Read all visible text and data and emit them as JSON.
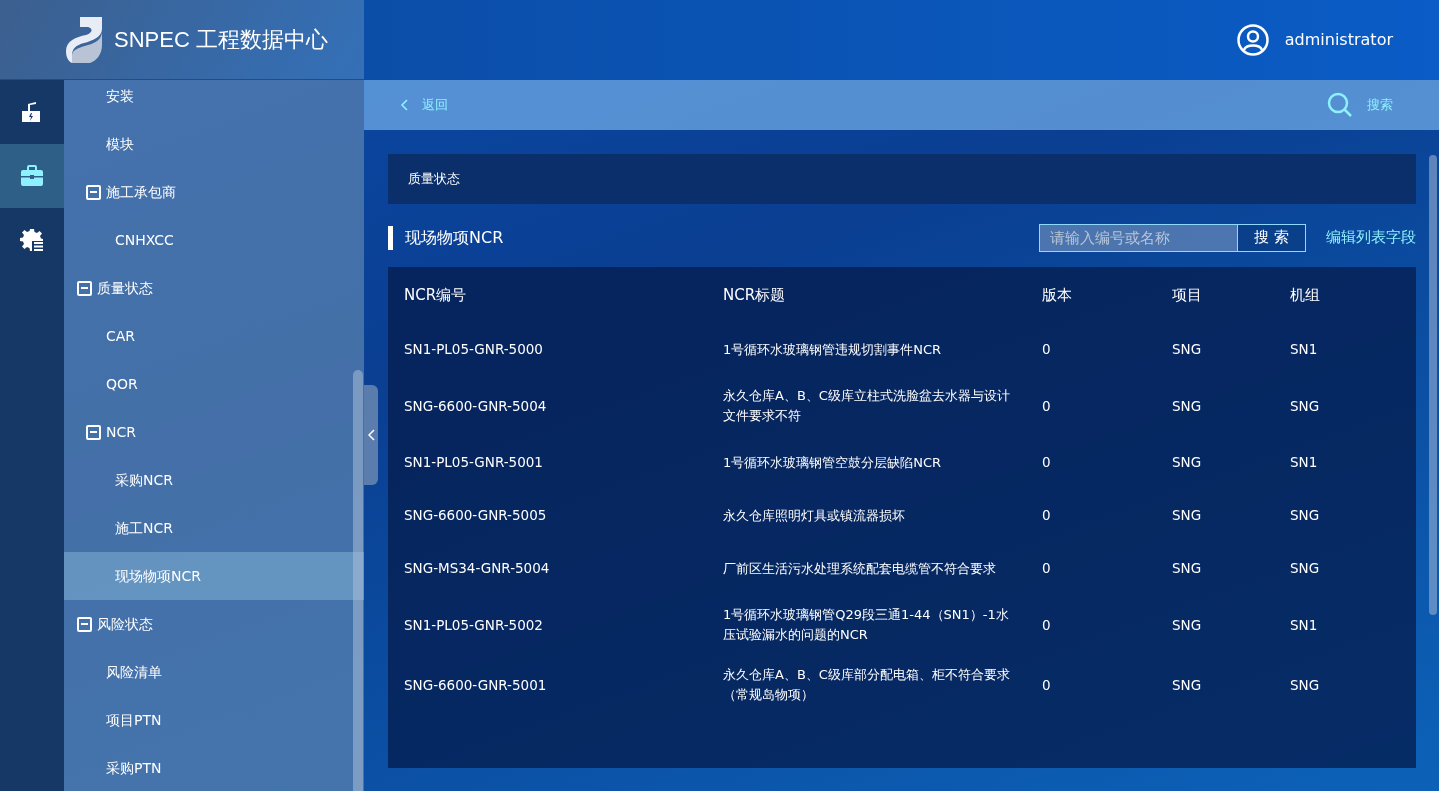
{
  "header": {
    "title": "SNPEC 工程数据中心",
    "user": "administrator"
  },
  "rail": [
    {
      "selected": false
    },
    {
      "selected": true
    },
    {
      "selected": false
    }
  ],
  "sidebar": {
    "items": [
      {
        "children": [
          {
            "label": "安装",
            "selected": false
          },
          {
            "label": "模块",
            "selected": false
          },
          {
            "label": "施工承包商",
            "expanded": true,
            "selected": false,
            "children": [
              {
                "label": "CNHXCC",
                "selected": false
              }
            ]
          }
        ]
      },
      {
        "label": "质量状态",
        "expanded": true,
        "selected": false,
        "children": [
          {
            "label": "CAR",
            "selected": false
          },
          {
            "label": "QOR",
            "selected": false
          },
          {
            "label": "NCR",
            "expanded": true,
            "selected": false,
            "children": [
              {
                "label": "采购NCR",
                "selected": false
              },
              {
                "label": "施工NCR",
                "selected": false
              },
              {
                "label": "现场物项NCR",
                "selected": true
              }
            ]
          }
        ]
      },
      {
        "label": "风险状态",
        "expanded": true,
        "selected": false,
        "children": [
          {
            "label": "风险清单",
            "selected": false
          },
          {
            "label": "项目PTN",
            "selected": false
          },
          {
            "label": "采购PTN",
            "selected": false
          }
        ]
      }
    ]
  },
  "toolbar": {
    "back": "返回",
    "search": "搜索"
  },
  "breadcrumb": "质量状态",
  "section": {
    "title": "现场物项NCR",
    "search_placeholder": "请输入编号或名称",
    "search_button": "搜 索",
    "edit_fields": "编辑列表字段"
  },
  "table": {
    "columns": [
      "NCR编号",
      "NCR标题",
      "版本",
      "项目",
      "机组"
    ],
    "rows": [
      [
        "SN1-PL05-GNR-5000",
        "1号循环水玻璃钢管违规切割事件NCR",
        "0",
        "SNG",
        "SN1"
      ],
      [
        "SNG-6600-GNR-5004",
        "永久仓库A、B、C级库立柱式洗脸盆去水器与设计文件要求不符",
        "0",
        "SNG",
        "SNG"
      ],
      [
        "SN1-PL05-GNR-5001",
        "1号循环水玻璃钢管空鼓分层缺陷NCR",
        "0",
        "SNG",
        "SN1"
      ],
      [
        "SNG-6600-GNR-5005",
        "永久仓库照明灯具或镇流器损坏",
        "0",
        "SNG",
        "SNG"
      ],
      [
        "SNG-MS34-GNR-5004",
        "厂前区生活污水处理系统配套电缆管不符合要求",
        "0",
        "SNG",
        "SNG"
      ],
      [
        "SN1-PL05-GNR-5002",
        "1号循环水玻璃钢管Q29段三通1-44（SN1）-1水压试验漏水的问题的NCR",
        "0",
        "SNG",
        "SN1"
      ],
      [
        "SNG-6600-GNR-5001",
        "永久仓库A、B、C级库部分配电箱、柜不符合要求（常规岛物项）",
        "0",
        "SNG",
        "SNG"
      ]
    ]
  }
}
